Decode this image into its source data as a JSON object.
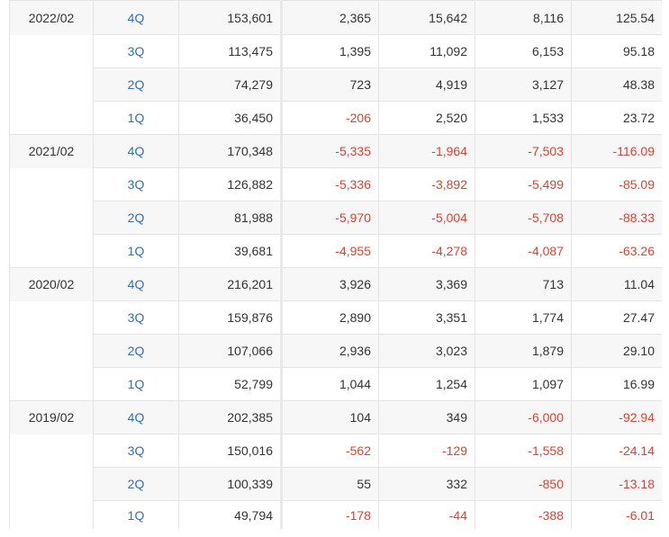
{
  "colors": {
    "negative": "#e0402f",
    "quarter_link": "#2f6fba",
    "stripe": "#f7f7f7",
    "grid": "#e4e4e4"
  },
  "rows": [
    {
      "year": "2022/02",
      "q": "4Q",
      "v": [
        "153,601",
        "2,365",
        "15,642",
        "8,116",
        "125.54"
      ]
    },
    {
      "year": "",
      "q": "3Q",
      "v": [
        "113,475",
        "1,395",
        "11,092",
        "6,153",
        "95.18"
      ]
    },
    {
      "year": "",
      "q": "2Q",
      "v": [
        "74,279",
        "723",
        "4,919",
        "3,127",
        "48.38"
      ]
    },
    {
      "year": "",
      "q": "1Q",
      "v": [
        "36,450",
        "-206",
        "2,520",
        "1,533",
        "23.72"
      ]
    },
    {
      "year": "2021/02",
      "q": "4Q",
      "v": [
        "170,348",
        "-5,335",
        "-1,964",
        "-7,503",
        "-116.09"
      ]
    },
    {
      "year": "",
      "q": "3Q",
      "v": [
        "126,882",
        "-5,336",
        "-3,892",
        "-5,499",
        "-85.09"
      ]
    },
    {
      "year": "",
      "q": "2Q",
      "v": [
        "81,988",
        "-5,970",
        "-5,004",
        "-5,708",
        "-88.33"
      ]
    },
    {
      "year": "",
      "q": "1Q",
      "v": [
        "39,681",
        "-4,955",
        "-4,278",
        "-4,087",
        "-63.26"
      ]
    },
    {
      "year": "2020/02",
      "q": "4Q",
      "v": [
        "216,201",
        "3,926",
        "3,369",
        "713",
        "11.04"
      ]
    },
    {
      "year": "",
      "q": "3Q",
      "v": [
        "159,876",
        "2,890",
        "3,351",
        "1,774",
        "27.47"
      ]
    },
    {
      "year": "",
      "q": "2Q",
      "v": [
        "107,066",
        "2,936",
        "3,023",
        "1,879",
        "29.10"
      ]
    },
    {
      "year": "",
      "q": "1Q",
      "v": [
        "52,799",
        "1,044",
        "1,254",
        "1,097",
        "16.99"
      ]
    },
    {
      "year": "2019/02",
      "q": "4Q",
      "v": [
        "202,385",
        "104",
        "349",
        "-6,000",
        "-92.94"
      ]
    },
    {
      "year": "",
      "q": "3Q",
      "v": [
        "150,016",
        "-562",
        "-129",
        "-1,558",
        "-24.14"
      ]
    },
    {
      "year": "",
      "q": "2Q",
      "v": [
        "100,339",
        "55",
        "332",
        "-850",
        "-13.18"
      ]
    },
    {
      "year": "",
      "q": "1Q",
      "v": [
        "49,794",
        "-178",
        "-44",
        "-388",
        "-6.01"
      ]
    }
  ]
}
